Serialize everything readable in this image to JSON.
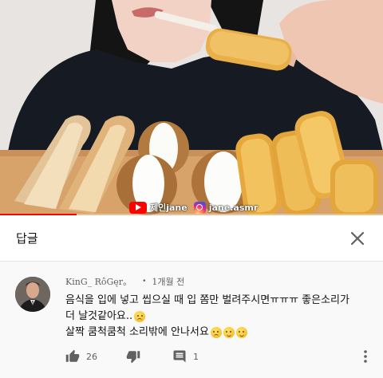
{
  "video": {
    "channel_watermark": "제인jane",
    "instagram_watermark": "jane.asmr",
    "progress": 0.2,
    "progress_color": "#ff0000"
  },
  "panel": {
    "title": "답글",
    "close_icon": "close-icon"
  },
  "comment": {
    "author": "KinG_ RôGęr。",
    "separator": "•",
    "time": "1개월 전",
    "text_line1": "음식을 입에 넣고 씹으실 때 입 쫌만 벌려주시면ㅠㅠㅠ 좋은소리가",
    "text_line2": "더 날것같아요..",
    "text_line3": "살짝 쿰척쿰척 소리밖에 안나서요",
    "like_count": "26",
    "reply_count": "1",
    "icons": [
      "thumbs-up-icon",
      "thumbs-down-icon",
      "reply-icon",
      "more-vertical-icon"
    ]
  }
}
